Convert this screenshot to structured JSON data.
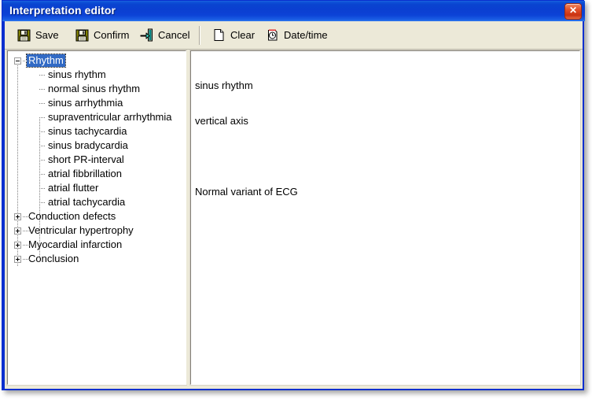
{
  "window": {
    "title": "Interpretation editor",
    "close_label": "✕"
  },
  "toolbar": {
    "buttons": [
      {
        "label": "Save",
        "icon": "floppy-disk-icon"
      },
      {
        "label": "Confirm",
        "icon": "floppy-disk-icon"
      },
      {
        "label": "Cancel",
        "icon": "exit-door-icon"
      },
      {
        "label": "Clear",
        "icon": "blank-page-icon"
      },
      {
        "label": "Date/time",
        "icon": "page-clock-icon"
      }
    ]
  },
  "tree": {
    "nodes": [
      {
        "label": "Rhythm",
        "level": 0,
        "state": "expanded",
        "selected": true
      },
      {
        "label": "sinus rhythm",
        "level": 1,
        "state": "leaf",
        "selected": false
      },
      {
        "label": "normal sinus rhythm",
        "level": 1,
        "state": "leaf",
        "selected": false
      },
      {
        "label": "sinus arrhythmia",
        "level": 1,
        "state": "leaf",
        "selected": false
      },
      {
        "label": "supraventricular arrhythmia",
        "level": 1,
        "state": "leaf",
        "selected": false
      },
      {
        "label": "sinus tachycardia",
        "level": 1,
        "state": "leaf",
        "selected": false
      },
      {
        "label": "sinus bradycardia",
        "level": 1,
        "state": "leaf",
        "selected": false
      },
      {
        "label": "short PR-interval",
        "level": 1,
        "state": "leaf",
        "selected": false
      },
      {
        "label": "atrial fibbrillation",
        "level": 1,
        "state": "leaf",
        "selected": false
      },
      {
        "label": "atrial flutter",
        "level": 1,
        "state": "leaf",
        "selected": false
      },
      {
        "label": "atrial tachycardia",
        "level": 1,
        "state": "leaf",
        "selected": false
      },
      {
        "label": "Conduction defects",
        "level": 0,
        "state": "collapsed",
        "selected": false
      },
      {
        "label": "Ventricular hypertrophy",
        "level": 0,
        "state": "collapsed",
        "selected": false
      },
      {
        "label": "Myocardial infarction",
        "level": 0,
        "state": "collapsed",
        "selected": false
      },
      {
        "label": "Conclusion",
        "level": 0,
        "state": "collapsed",
        "selected": false
      }
    ]
  },
  "editor": {
    "lines": [
      "sinus rhythm",
      "vertical axis",
      "",
      "Normal variant of ECG"
    ]
  },
  "colors": {
    "titlebar_blue": "#0a3fd1",
    "window_border": "#0a2fcf",
    "toolbar_face": "#ece9d8",
    "selection_blue": "#316ac5",
    "close_red": "#c93211"
  }
}
